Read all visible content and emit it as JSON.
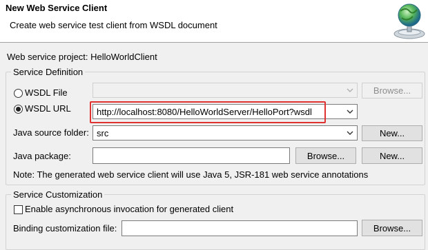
{
  "header": {
    "title": "New Web Service Client",
    "subtitle": "Create web service test client from WSDL document",
    "icon": "globe-web-service-icon"
  },
  "project": {
    "label": "Web service project: HelloWorldClient"
  },
  "service_definition": {
    "group_title": "Service Definition",
    "wsdl_file_label": "WSDL File",
    "wsdl_file_selected": false,
    "wsdl_file_value": "",
    "browse_label": "Browse...",
    "wsdl_url_label": "WSDL URL",
    "wsdl_url_selected": true,
    "wsdl_url_value": "http://localhost:8080/HelloWorldServer/HelloPort?wsdl",
    "java_source_folder_label": "Java source folder:",
    "java_source_folder_value": "src",
    "new_label": "New...",
    "java_package_label": "Java package:",
    "java_package_value": "",
    "package_browse_label": "Browse...",
    "package_new_label": "New...",
    "note": "Note: The generated web service client will use Java 5, JSR-181 web service annotations"
  },
  "service_customization": {
    "group_title": "Service Customization",
    "async_label": "Enable asynchronous invocation for generated client",
    "async_checked": false,
    "binding_label": "Binding customization file:",
    "binding_value": "",
    "browse_label": "Browse..."
  },
  "colors": {
    "highlight": "#e03030",
    "header_bg": "#ffffff",
    "dialog_bg": "#f0f0f0"
  }
}
